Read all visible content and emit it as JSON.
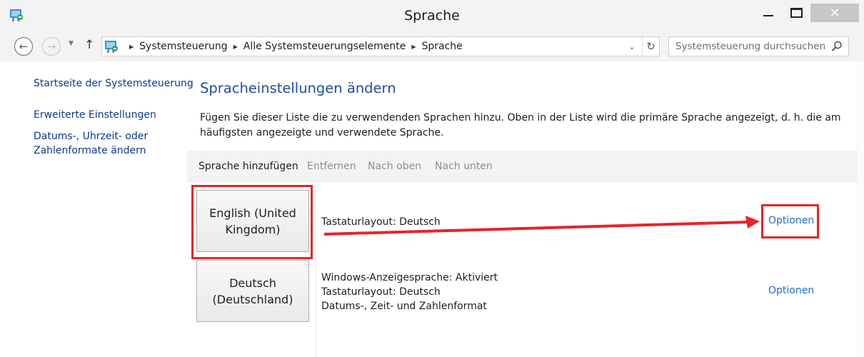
{
  "window": {
    "title": "Sprache",
    "close_symbol": "✕",
    "accent_color": "#1f4ea3",
    "annotation_color": "#e8232a"
  },
  "navigation": {
    "back_symbol": "←",
    "forward_symbol": "→",
    "dropdown_symbol": "▼",
    "up_symbol": "↑",
    "breadcrumbs": [
      "Systemsteuerung",
      "Alle Systemsteuerungselemente",
      "Sprache"
    ],
    "crumb_separator": "▶",
    "address_dropdown_symbol": "⌄",
    "refresh_symbol": "↻",
    "search_placeholder": "Systemsteuerung durchsuchen"
  },
  "sidebar": {
    "items": [
      "Startseite der Systemsteuerung",
      "Erweiterte Einstellungen",
      "Datums-, Uhrzeit- oder",
      "Zahlenformate ändern"
    ]
  },
  "main": {
    "title": "Spracheinstellungen ändern",
    "description_line1": "Fügen Sie dieser Liste die zu verwendenden Sprachen hinzu. Oben in der Liste wird die primäre Sprache angezeigt, d. h. die am",
    "description_line2": "häufigsten angezeigte und verwendete Sprache.",
    "toolbar": {
      "add": "Sprache hinzufügen",
      "remove": "Entfernen",
      "move_up": "Nach oben",
      "move_down": "Nach unten"
    },
    "languages": [
      {
        "name_line1": "English (United",
        "name_line2": "Kingdom)",
        "info": [
          "Tastaturlayout: Deutsch"
        ],
        "options": "Optionen"
      },
      {
        "name_line1": "Deutsch",
        "name_line2": "(Deutschland)",
        "info": [
          "Windows-Anzeigesprache: Aktiviert",
          "Tastaturlayout: Deutsch",
          "Datums-, Zeit- und Zahlenformat"
        ],
        "options": "Optionen"
      }
    ]
  }
}
